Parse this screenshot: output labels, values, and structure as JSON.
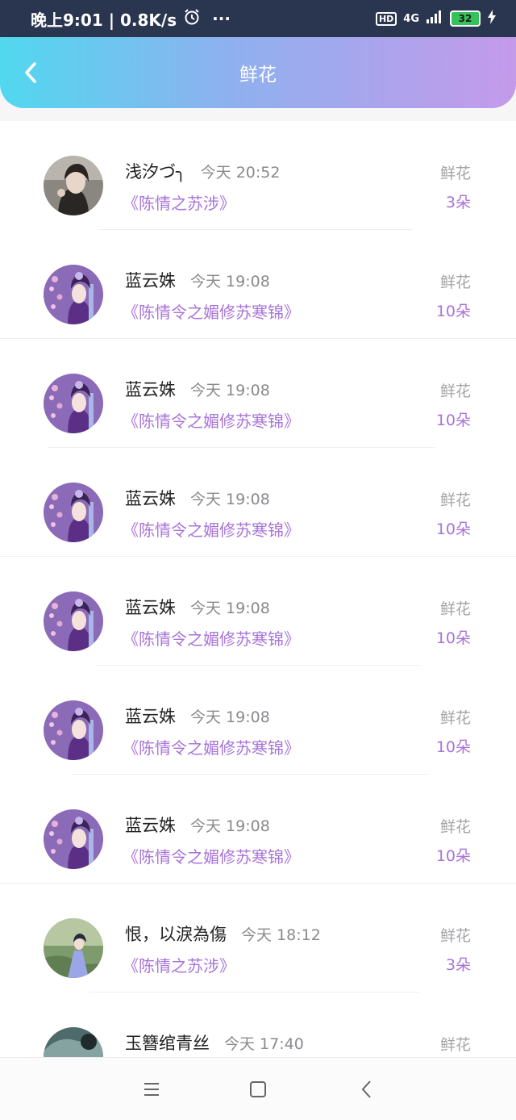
{
  "status_bar": {
    "time_speed": "晚上9:01 | 0.8K/s",
    "more": "···",
    "hd": "HD",
    "network": "4G",
    "battery": "32"
  },
  "header": {
    "title": "鲜花"
  },
  "records": [
    {
      "user": "浅汐づ╮",
      "time": "今天 20:52",
      "book": "《陈情之苏涉》",
      "label": "鲜花",
      "count": "3朵",
      "avatar": "photo-girl-avatar"
    },
    {
      "user": "蓝云姝",
      "time": "今天 19:08",
      "book": "《陈情令之媚修苏寒锦》",
      "label": "鲜花",
      "count": "10朵",
      "avatar": "illustrated-lady-avatar"
    },
    {
      "user": "蓝云姝",
      "time": "今天 19:08",
      "book": "《陈情令之媚修苏寒锦》",
      "label": "鲜花",
      "count": "10朵",
      "avatar": "illustrated-lady-avatar"
    },
    {
      "user": "蓝云姝",
      "time": "今天 19:08",
      "book": "《陈情令之媚修苏寒锦》",
      "label": "鲜花",
      "count": "10朵",
      "avatar": "illustrated-lady-avatar"
    },
    {
      "user": "蓝云姝",
      "time": "今天 19:08",
      "book": "《陈情令之媚修苏寒锦》",
      "label": "鲜花",
      "count": "10朵",
      "avatar": "illustrated-lady-avatar"
    },
    {
      "user": "蓝云姝",
      "time": "今天 19:08",
      "book": "《陈情令之媚修苏寒锦》",
      "label": "鲜花",
      "count": "10朵",
      "avatar": "illustrated-lady-avatar"
    },
    {
      "user": "蓝云姝",
      "time": "今天 19:08",
      "book": "《陈情令之媚修苏寒锦》",
      "label": "鲜花",
      "count": "10朵",
      "avatar": "illustrated-lady-avatar"
    },
    {
      "user": "恨，以淚為傷",
      "time": "今天 18:12",
      "book": "《陈情之苏涉》",
      "label": "鲜花",
      "count": "3朵",
      "avatar": "costume-figure-avatar"
    },
    {
      "user": "玉簪绾青丝",
      "time": "今天 17:40",
      "book": "",
      "label": "鲜花",
      "count": "",
      "avatar": "landscape-avatar"
    }
  ],
  "nav": {
    "menu_icon": "menu-icon",
    "home_icon": "home-square-icon",
    "back_icon": "back-triangle-icon"
  },
  "colors": {
    "accent": "#a874d8",
    "header_start": "#51d8ef",
    "header_end": "#c49aeb"
  }
}
